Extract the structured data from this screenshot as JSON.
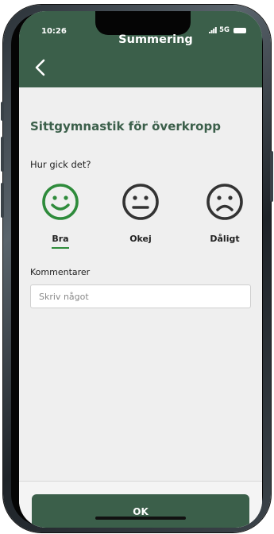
{
  "status": {
    "time": "10:26",
    "network": "5G"
  },
  "header": {
    "title": "Summering"
  },
  "activity": {
    "title": "Sittgymnastik för överkropp"
  },
  "question": "Hur gick det?",
  "moods": [
    {
      "label": "Bra",
      "icon": "smile-icon",
      "color": "#2e8b3b",
      "selected": true
    },
    {
      "label": "Okej",
      "icon": "neutral-face-icon",
      "color": "#333333",
      "selected": false
    },
    {
      "label": "Dåligt",
      "icon": "sad-face-icon",
      "color": "#333333",
      "selected": false
    }
  ],
  "comments": {
    "label": "Kommentarer",
    "placeholder": "Skriv något",
    "value": ""
  },
  "footer": {
    "ok_label": "OK"
  },
  "colors": {
    "accent": "#3b5f4a",
    "selected": "#2e8b3b",
    "background": "#efefef"
  }
}
